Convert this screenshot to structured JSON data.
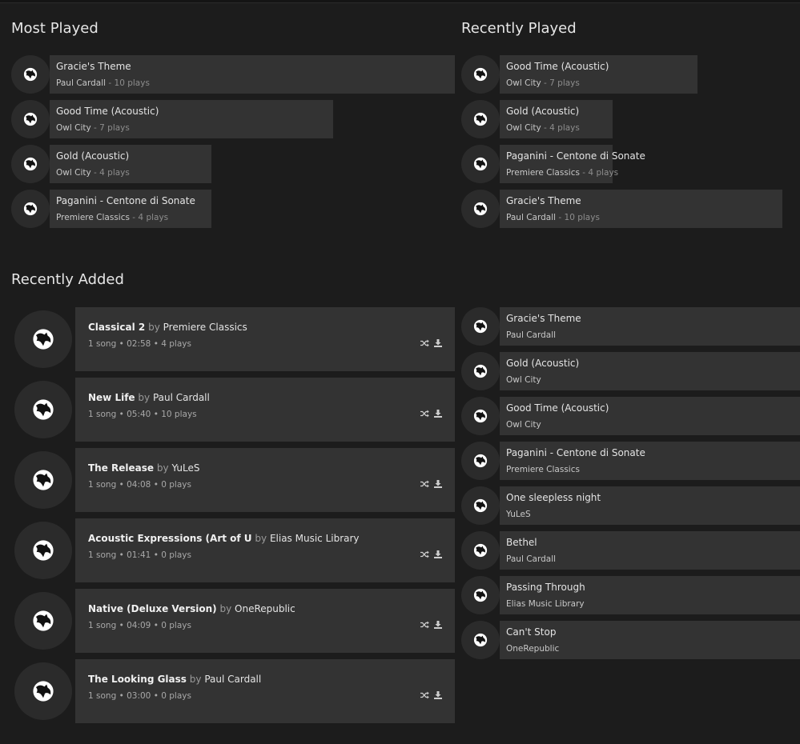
{
  "sections": {
    "most_played": "Most Played",
    "recently_played": "Recently Played",
    "recently_added": "Recently Added"
  },
  "most_played": [
    {
      "title": "Gracie's Theme",
      "artist": "Paul Cardall",
      "plays": "- 10 plays",
      "fill": 1.0
    },
    {
      "title": "Good Time (Acoustic)",
      "artist": "Owl City",
      "plays": "- 7 plays",
      "fill": 0.7
    },
    {
      "title": "Gold (Acoustic)",
      "artist": "Owl City",
      "plays": "- 4 plays",
      "fill": 0.4
    },
    {
      "title": "Paganini - Centone di Sonate",
      "artist": "Premiere Classics",
      "plays": "- 4 plays",
      "fill": 0.4
    }
  ],
  "recently_played": [
    {
      "title": "Good Time (Acoustic)",
      "artist": "Owl City",
      "plays": "- 7 plays",
      "fill": 0.7
    },
    {
      "title": "Gold (Acoustic)",
      "artist": "Owl City",
      "plays": "- 4 plays",
      "fill": 0.4
    },
    {
      "title": "Paganini - Centone di Sonate",
      "artist": "Premiere Classics",
      "plays": "- 4 plays",
      "fill": 0.4
    },
    {
      "title": "Gracie's Theme",
      "artist": "Paul Cardall",
      "plays": "- 10 plays",
      "fill": 1.0
    }
  ],
  "recently_added_albums": [
    {
      "title": "Classical 2",
      "by": "by",
      "artist": "Premiere Classics",
      "meta": "1 song • 02:58 • 4 plays"
    },
    {
      "title": "New Life",
      "by": "by",
      "artist": "Paul Cardall",
      "meta": "1 song • 05:40 • 10 plays"
    },
    {
      "title": "The Release",
      "by": "by",
      "artist": "YuLeS",
      "meta": "1 song • 04:08 • 0 plays"
    },
    {
      "title": "Acoustic Expressions (Art of U",
      "by": "by",
      "artist": "Elias Music Library",
      "meta": "1 song • 01:41 • 0 plays"
    },
    {
      "title": "Native (Deluxe Version)",
      "by": "by",
      "artist": "OneRepublic",
      "meta": "1 song • 04:09 • 0 plays"
    },
    {
      "title": "The Looking Glass",
      "by": "by",
      "artist": "Paul Cardall",
      "meta": "1 song • 03:00 • 0 plays"
    }
  ],
  "recently_added_songs": [
    {
      "title": "Gracie's Theme",
      "artist": "Paul Cardall"
    },
    {
      "title": "Gold (Acoustic)",
      "artist": "Owl City"
    },
    {
      "title": "Good Time (Acoustic)",
      "artist": "Owl City"
    },
    {
      "title": "Paganini - Centone di Sonate",
      "artist": "Premiere Classics"
    },
    {
      "title": "One sleepless night",
      "artist": "YuLeS"
    },
    {
      "title": "Bethel",
      "artist": "Paul Cardall"
    },
    {
      "title": "Passing Through",
      "artist": "Elias Music Library"
    },
    {
      "title": "Can't Stop",
      "artist": "OneRepublic"
    }
  ],
  "icons": {
    "album_art": "album-art-icon",
    "shuffle": "shuffle-icon",
    "download": "download-icon"
  },
  "colors": {
    "background": "#1c1c1c",
    "panel": "#333333",
    "thumb": "#2b2b2b",
    "text": "#e4e4e4",
    "muted": "#8d8d8d"
  }
}
